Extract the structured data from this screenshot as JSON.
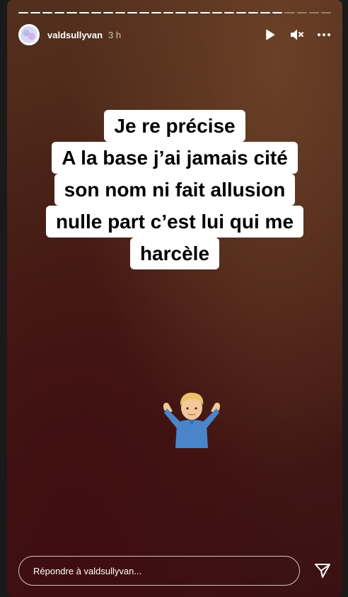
{
  "story": {
    "progress": {
      "total_segments": 26,
      "completed_segments": 22
    },
    "author": {
      "username": "valdsullyvan",
      "time_ago": "3 h"
    },
    "controls": {
      "play_icon": "play-icon",
      "mute_icon": "mute-icon",
      "more_icon": "more-icon"
    },
    "caption_lines": [
      "Je re précise",
      "A la base j’ai jamais cité",
      "son nom ni fait allusion",
      "nulle part c’est lui qui me",
      "harcèle"
    ],
    "emoji": "person-shrugging-emoji",
    "reply": {
      "placeholder": "Répondre à valdsullyvan..."
    },
    "send_icon": "send-icon"
  }
}
